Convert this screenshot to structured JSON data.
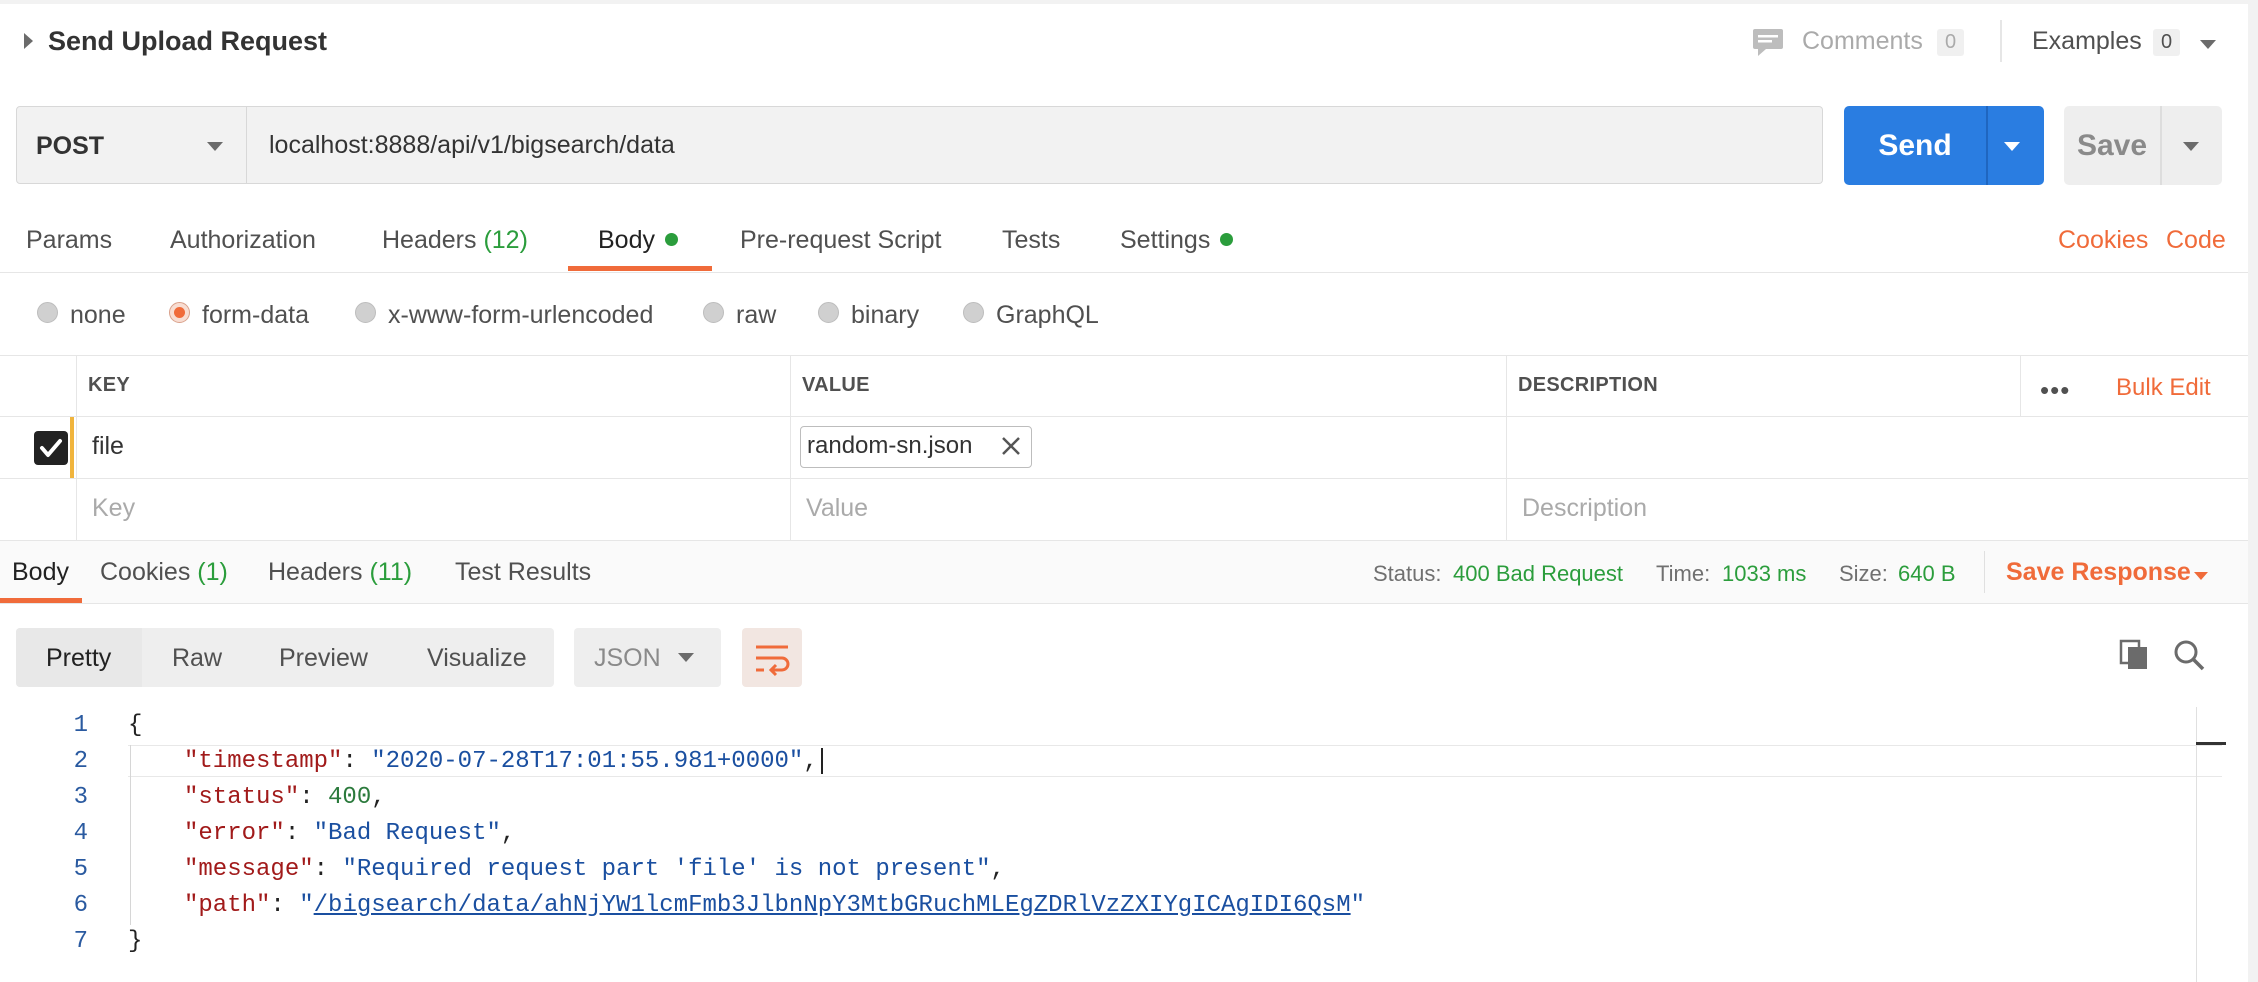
{
  "request": {
    "title": "Send Upload Request",
    "comments_label": "Comments",
    "comments_count": "0",
    "examples_label": "Examples",
    "examples_count": "0",
    "method": "POST",
    "url": "localhost:8888/api/v1/bigsearch/data",
    "send_label": "Send",
    "save_label": "Save"
  },
  "request_tabs": {
    "params": "Params",
    "authorization": "Authorization",
    "headers": "Headers",
    "headers_count": "(12)",
    "body": "Body",
    "pre_request_script": "Pre-request Script",
    "tests": "Tests",
    "settings": "Settings",
    "cookies": "Cookies",
    "code": "Code"
  },
  "body_types": {
    "selected": "form-data",
    "options": [
      "none",
      "form-data",
      "x-www-form-urlencoded",
      "raw",
      "binary",
      "GraphQL"
    ]
  },
  "params_table": {
    "columns": [
      "KEY",
      "VALUE",
      "DESCRIPTION"
    ],
    "bulk_edit": "Bulk Edit",
    "more": "•••",
    "rows": [
      {
        "checked": true,
        "key": "file",
        "value": "random-sn.json",
        "description": ""
      }
    ],
    "placeholders": {
      "key": "Key",
      "value": "Value",
      "description": "Description"
    }
  },
  "response_tabs": {
    "body": "Body",
    "cookies": "Cookies",
    "cookies_count": "(1)",
    "headers": "Headers",
    "headers_count": "(11)",
    "test_results": "Test Results"
  },
  "response_meta": {
    "status_label": "Status:",
    "status_value": "400 Bad Request",
    "time_label": "Time:",
    "time_value": "1033 ms",
    "size_label": "Size:",
    "size_value": "640 B",
    "save_response": "Save Response"
  },
  "view_tabs": {
    "options": [
      "Pretty",
      "Raw",
      "Preview",
      "Visualize"
    ],
    "selected": "Pretty",
    "format": "JSON"
  },
  "response_body": {
    "line_numbers": [
      "1",
      "2",
      "3",
      "4",
      "5",
      "6",
      "7"
    ],
    "open_brace": "{",
    "close_brace": "}",
    "fields": [
      {
        "key": "\"timestamp\"",
        "value": "\"2020-07-28T17:01:55.981+0000\"",
        "type": "string"
      },
      {
        "key": "\"status\"",
        "value": "400",
        "type": "number"
      },
      {
        "key": "\"error\"",
        "value": "\"Bad Request\"",
        "type": "string"
      },
      {
        "key": "\"message\"",
        "value": "\"Required request part 'file' is not present\"",
        "type": "string"
      },
      {
        "key": "\"path\"",
        "value": "/bigsearch/data/ahNjYW1lcmFmb3JlbnNpY3MtbGRuchMLEgZDRlVzZXIYgICAgIDI6QsM",
        "type": "url"
      }
    ]
  },
  "colors": {
    "accent": "#f06b3a",
    "send": "#2a7de1",
    "success": "#2b9d3c",
    "json_key": "#a11a1a",
    "json_string": "#1a4fa0"
  },
  "icons": [
    "caret-right-icon",
    "comment-icon",
    "chevron-down-icon",
    "check-icon",
    "close-icon",
    "wrap-lines-icon",
    "copy-icon",
    "search-icon"
  ]
}
